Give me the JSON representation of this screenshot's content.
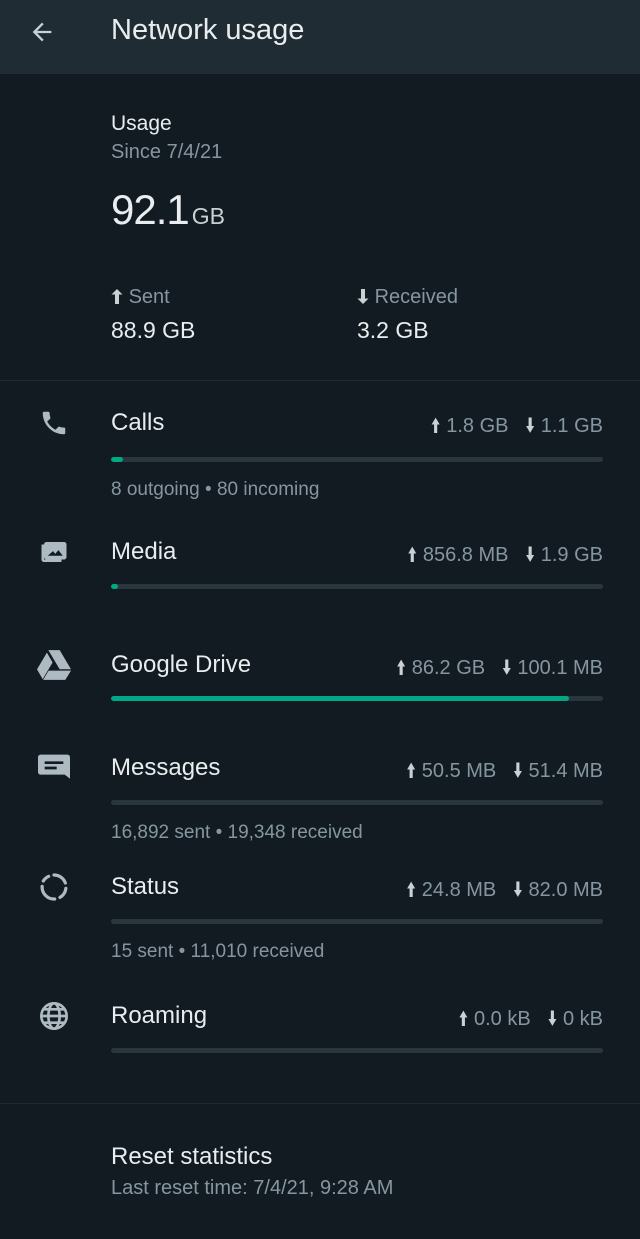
{
  "header": {
    "title": "Network usage"
  },
  "summary": {
    "label": "Usage",
    "since": "Since 7/4/21",
    "total_value": "92.1",
    "total_unit": "GB",
    "sent_label": "Sent",
    "sent_value": "88.9 GB",
    "received_label": "Received",
    "received_value": "3.2 GB"
  },
  "categories": [
    {
      "name": "Calls",
      "sent": "1.8 GB",
      "received": "1.1 GB",
      "detail": "8 outgoing • 80 incoming",
      "usage_fraction": 0.025
    },
    {
      "name": "Media",
      "sent": "856.8 MB",
      "received": "1.9 GB",
      "detail": "",
      "usage_fraction": 0.015
    },
    {
      "name": "Google Drive",
      "sent": "86.2 GB",
      "received": "100.1 MB",
      "detail": "",
      "usage_fraction": 0.93
    },
    {
      "name": "Messages",
      "sent": "50.5 MB",
      "received": "51.4 MB",
      "detail": "16,892 sent • 19,348 received",
      "usage_fraction": 0.0
    },
    {
      "name": "Status",
      "sent": "24.8 MB",
      "received": "82.0 MB",
      "detail": "15 sent • 11,010 received",
      "usage_fraction": 0.0
    },
    {
      "name": "Roaming",
      "sent": "0.0 kB",
      "received": "0 kB",
      "detail": "",
      "usage_fraction": 0.0
    }
  ],
  "reset": {
    "label": "Reset statistics",
    "last_reset": "Last reset time: 7/4/21, 9:28 AM"
  },
  "colors": {
    "accent": "#00a884",
    "background": "#121b22",
    "appbar": "#1f2c34"
  }
}
